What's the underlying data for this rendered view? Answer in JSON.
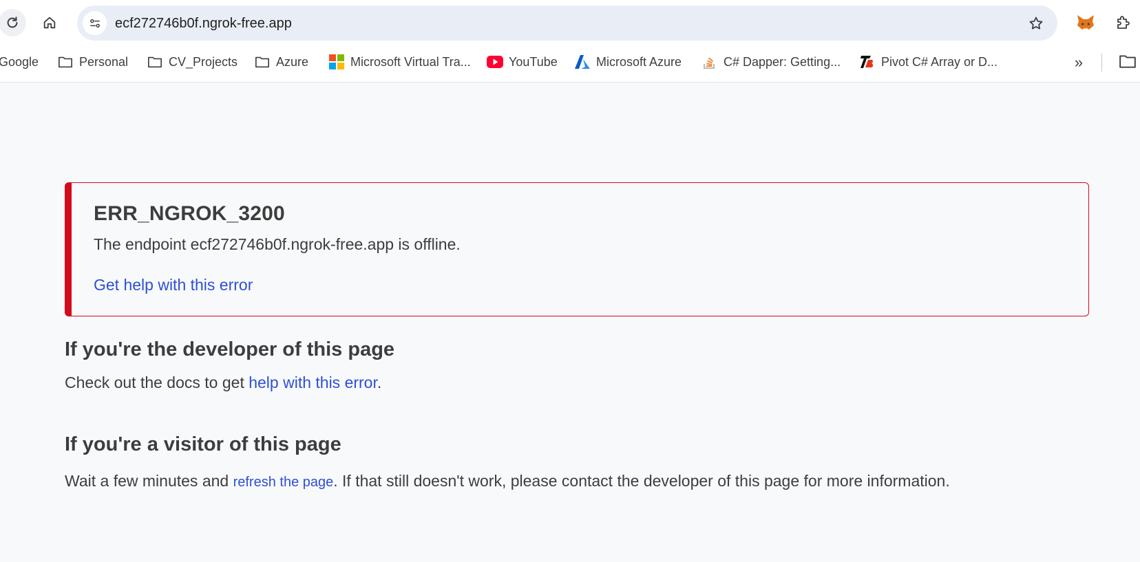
{
  "browser": {
    "url": "ecf272746b0f.ngrok-free.app",
    "bookmarks": [
      {
        "label": "Google",
        "icon": "google-icon"
      },
      {
        "label": "Personal",
        "icon": "folder-icon"
      },
      {
        "label": "CV_Projects",
        "icon": "folder-icon"
      },
      {
        "label": "Azure",
        "icon": "folder-icon"
      },
      {
        "label": "Microsoft Virtual Tra...",
        "icon": "microsoft-icon"
      },
      {
        "label": "YouTube",
        "icon": "youtube-icon"
      },
      {
        "label": "Microsoft Azure",
        "icon": "azure-icon"
      },
      {
        "label": "C# Dapper: Getting...",
        "icon": "stackoverflow-icon"
      },
      {
        "label": "Pivot C# Array or D...",
        "icon": "bt-logo-icon"
      }
    ],
    "more_bookmarks_glyph": "»"
  },
  "error": {
    "code": "ERR_NGROK_3200",
    "message": "The endpoint ecf272746b0f.ngrok-free.app is offline.",
    "help_link": "Get help with this error"
  },
  "developer": {
    "heading": "If you're the developer of this page",
    "text_before": "Check out the docs to get ",
    "link": "help with this error",
    "text_after": "."
  },
  "visitor": {
    "heading": "If you're a visitor of this page",
    "text_before": "Wait a few minutes and ",
    "link": "refresh the page",
    "text_after": ". If that still doesn't work, please contact the developer of this page for more information."
  },
  "colors": {
    "error_red": "#d30c1c",
    "link_blue": "#2e4fd6",
    "text": "#3d3d3d",
    "page_bg": "#f8f9fb"
  }
}
